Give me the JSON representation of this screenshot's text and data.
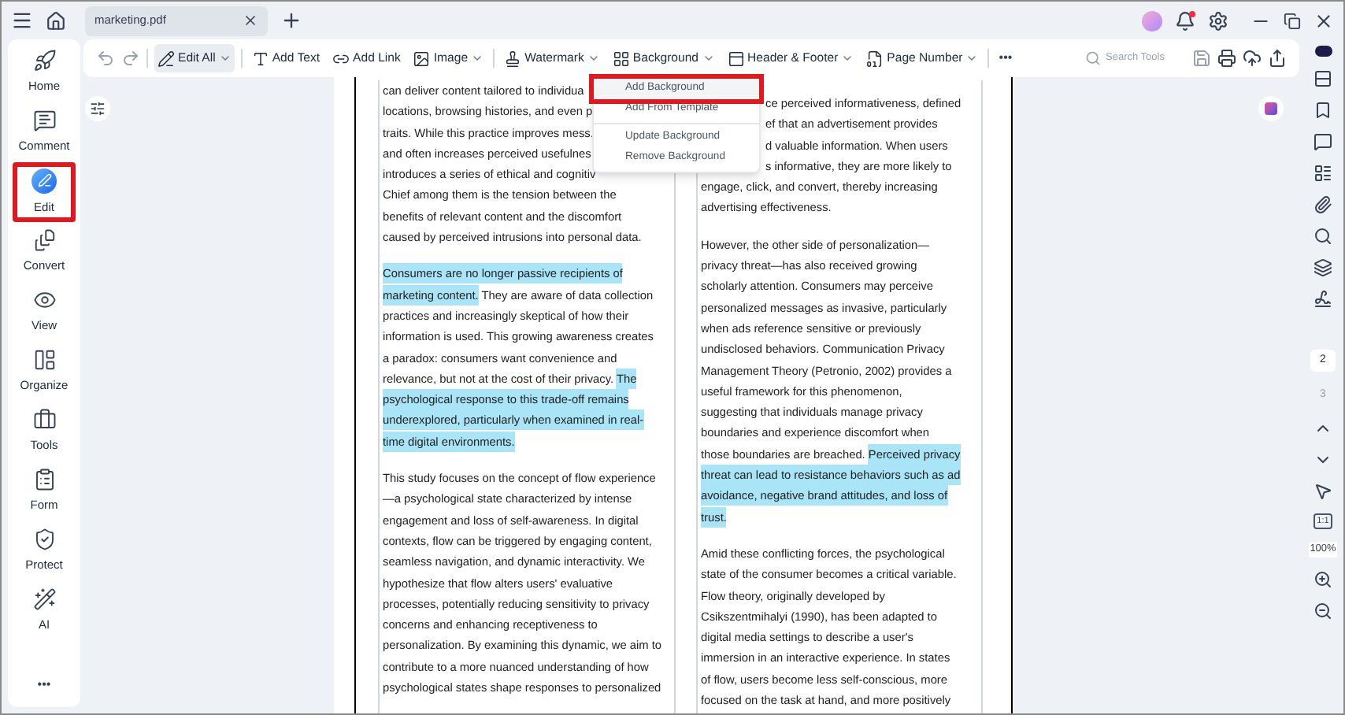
{
  "window": {
    "tab_title": "marketing.pdf"
  },
  "sidebar": {
    "items": [
      {
        "label": "Home",
        "kind": "home",
        "selected": false
      },
      {
        "label": "Comment",
        "kind": "comment",
        "selected": false
      },
      {
        "label": "Edit",
        "kind": "edit",
        "selected": true
      },
      {
        "label": "Convert",
        "kind": "convert",
        "selected": false
      },
      {
        "label": "View",
        "kind": "view",
        "selected": false
      },
      {
        "label": "Organize",
        "kind": "organize",
        "selected": false
      },
      {
        "label": "Tools",
        "kind": "tools",
        "selected": false
      },
      {
        "label": "Form",
        "kind": "form",
        "selected": false
      },
      {
        "label": "Protect",
        "kind": "protect",
        "selected": false
      },
      {
        "label": "AI",
        "kind": "ai",
        "selected": false
      }
    ],
    "more": "•••"
  },
  "toolbar": {
    "items": [
      {
        "label": "Edit All",
        "kind": "edit_all",
        "selected": true,
        "dropdown": true
      },
      {
        "label": "Add Text",
        "kind": "text",
        "selected": false,
        "dropdown": false
      },
      {
        "label": "Add Link",
        "kind": "link",
        "selected": false,
        "dropdown": false
      },
      {
        "label": "Image",
        "kind": "image",
        "selected": false,
        "dropdown": true
      },
      {
        "label": "Watermark",
        "kind": "watermark",
        "selected": false,
        "dropdown": true
      },
      {
        "label": "Background",
        "kind": "background",
        "selected": false,
        "dropdown": true
      },
      {
        "label": "Header & Footer",
        "kind": "header",
        "selected": false,
        "dropdown": true
      },
      {
        "label": "Page Number",
        "kind": "page_number",
        "selected": false,
        "dropdown": true
      }
    ],
    "more": "•••",
    "search": {
      "placeholder": "Search Tools"
    }
  },
  "menu": {
    "items": [
      {
        "label": "Add Background",
        "selected": true
      },
      {
        "label": "Add From Template",
        "selected": false
      },
      {
        "label": "Update Background",
        "selected": false
      },
      {
        "label": "Remove Background",
        "selected": false
      }
    ]
  },
  "document": {
    "columns": [
      {
        "paragraphs": [
          {
            "kind": "cut_end",
            "lines": [
              [
                {
                  "text": "can deliver content tailored to individua",
                  "highlighted": false
                }
              ],
              [
                {
                  "text": "locations, browsing histories, and even p",
                  "highlighted": false
                }
              ],
              [
                {
                  "text": "traits. While this practice improves mess.",
                  "highlighted": false
                }
              ],
              [
                {
                  "text": "and often increases perceived usefulnes",
                  "highlighted": false
                }
              ],
              [
                {
                  "text": "introduces a series of ethical and cognitiv",
                  "highlighted": false
                }
              ]
            ]
          },
          {
            "kind": "full",
            "lines": [
              [
                {
                  "text": "Chief among them is the tension between the",
                  "highlighted": false
                }
              ],
              [
                {
                  "text": "benefits of relevant content and the discomfort",
                  "highlighted": false
                }
              ],
              [
                {
                  "text": "caused by perceived intrusions into personal data.",
                  "highlighted": false
                }
              ]
            ]
          },
          {
            "kind": "full",
            "lines": [
              [
                {
                  "text": "Consumers are no longer passive recipients of",
                  "highlighted": true
                }
              ],
              [
                {
                  "text": "marketing content.",
                  "highlighted": true
                },
                {
                  "text": " They are aware of data collection",
                  "highlighted": false
                }
              ],
              [
                {
                  "text": "practices and increasingly skeptical of how their",
                  "highlighted": false
                }
              ],
              [
                {
                  "text": "information is used. This growing awareness creates",
                  "highlighted": false
                }
              ],
              [
                {
                  "text": "a paradox: consumers want convenience and",
                  "highlighted": false
                }
              ],
              [
                {
                  "text": "relevance, but not at the cost of their privacy. ",
                  "highlighted": false
                },
                {
                  "text": "The",
                  "highlighted": true
                }
              ],
              [
                {
                  "text": "psychological response to this trade-off remains",
                  "highlighted": true
                }
              ],
              [
                {
                  "text": "underexplored, particularly when examined in real-",
                  "highlighted": true
                }
              ],
              [
                {
                  "text": "time digital environments.",
                  "highlighted": true
                }
              ]
            ]
          },
          {
            "kind": "full",
            "lines": [
              [
                {
                  "text": "This study focuses on the concept of flow experience",
                  "highlighted": false
                }
              ],
              [
                {
                  "text": "—a psychological state characterized by intense",
                  "highlighted": false
                }
              ],
              [
                {
                  "text": "engagement and loss of self-awareness. In digital",
                  "highlighted": false
                }
              ],
              [
                {
                  "text": "contexts, flow can be triggered by engaging content,",
                  "highlighted": false
                }
              ],
              [
                {
                  "text": "seamless navigation, and dynamic interactivity. We",
                  "highlighted": false
                }
              ],
              [
                {
                  "text": "hypothesize that flow alters users' evaluative",
                  "highlighted": false
                }
              ],
              [
                {
                  "text": "processes, potentially reducing sensitivity to privacy",
                  "highlighted": false
                }
              ],
              [
                {
                  "text": "concerns and enhancing receptiveness to",
                  "highlighted": false
                }
              ],
              [
                {
                  "text": "personalization. By examining this dynamic, we aim to",
                  "highlighted": false
                }
              ],
              [
                {
                  "text": "contribute to a more nuanced understanding of how",
                  "highlighted": false
                }
              ],
              [
                {
                  "text": "psychological states shape responses to personalized",
                  "highlighted": false
                }
              ]
            ]
          }
        ]
      },
      {
        "paragraphs": [
          {
            "kind": "cut_start",
            "lines": [
              [
                {
                  "text": "ce perceived informativeness, defined",
                  "highlighted": false
                }
              ],
              [
                {
                  "text": "ef that an advertisement provides",
                  "highlighted": false
                }
              ],
              [
                {
                  "text": "d valuable information. When users",
                  "highlighted": false
                }
              ],
              [
                {
                  "text": "s informative, they are more likely to",
                  "highlighted": false
                }
              ]
            ]
          },
          {
            "kind": "full",
            "lines": [
              [
                {
                  "text": "engage, click, and convert, thereby increasing",
                  "highlighted": false
                }
              ],
              [
                {
                  "text": "advertising effectiveness.",
                  "highlighted": false
                }
              ]
            ]
          },
          {
            "kind": "full",
            "lines": [
              [
                {
                  "text": "However, the other side of personalization—",
                  "highlighted": false
                }
              ],
              [
                {
                  "text": "privacy threat—has also received growing",
                  "highlighted": false
                }
              ],
              [
                {
                  "text": "scholarly attention. Consumers may perceive",
                  "highlighted": false
                }
              ],
              [
                {
                  "text": "personalized messages as invasive, particularly",
                  "highlighted": false
                }
              ],
              [
                {
                  "text": "when ads reference sensitive or previously",
                  "highlighted": false
                }
              ],
              [
                {
                  "text": "undisclosed behaviors. Communication Privacy",
                  "highlighted": false
                }
              ],
              [
                {
                  "text": "Management Theory (Petronio, 2002) provides a",
                  "highlighted": false
                }
              ],
              [
                {
                  "text": "useful framework for this phenomenon,",
                  "highlighted": false
                }
              ],
              [
                {
                  "text": "suggesting that individuals manage privacy",
                  "highlighted": false
                }
              ],
              [
                {
                  "text": "boundaries and experience discomfort when",
                  "highlighted": false
                }
              ],
              [
                {
                  "text": "those boundaries are breached. ",
                  "highlighted": false
                },
                {
                  "text": "Perceived privacy",
                  "highlighted": true
                }
              ],
              [
                {
                  "text": "threat can lead to resistance behaviors such as ad",
                  "highlighted": true
                }
              ],
              [
                {
                  "text": "avoidance, negative brand attitudes, and loss of",
                  "highlighted": true
                }
              ],
              [
                {
                  "text": "trust.",
                  "highlighted": true
                }
              ]
            ]
          },
          {
            "kind": "full",
            "lines": [
              [
                {
                  "text": "Amid these conflicting forces, the psychological",
                  "highlighted": false
                }
              ],
              [
                {
                  "text": "state of the consumer becomes a critical variable.",
                  "highlighted": false
                }
              ],
              [
                {
                  "text": "Flow theory, originally developed by",
                  "highlighted": false
                }
              ],
              [
                {
                  "text": "Csikszentmihalyi (1990), has been adapted to",
                  "highlighted": false
                }
              ],
              [
                {
                  "text": "digital media settings to describe a user's",
                  "highlighted": false
                }
              ],
              [
                {
                  "text": "immersion in an interactive experience. In states",
                  "highlighted": false
                }
              ],
              [
                {
                  "text": "of flow, users become less self-conscious, more",
                  "highlighted": false
                }
              ],
              [
                {
                  "text": "focused on the task at hand, and more positively",
                  "highlighted": false
                }
              ]
            ]
          }
        ]
      }
    ]
  },
  "right_rail": {
    "pages": [
      {
        "label": "2",
        "selected": true
      },
      {
        "label": "3",
        "selected": false
      }
    ],
    "actual_size": "1:1",
    "zoom": "100%"
  }
}
